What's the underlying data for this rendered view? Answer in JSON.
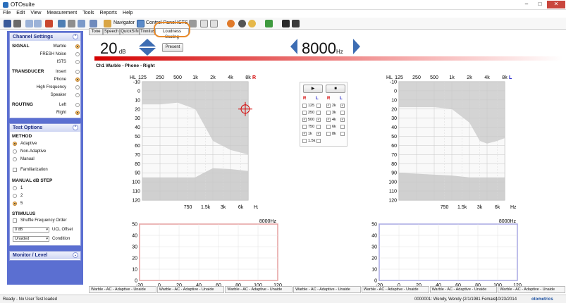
{
  "window": {
    "title": "OTOsuite",
    "min_label": "–",
    "max_label": "□",
    "close_label": "✕"
  },
  "menu": [
    "File",
    "Edit",
    "View",
    "Measurement",
    "Tools",
    "Reports",
    "Help"
  ],
  "toolbar": {
    "navigator_label": "Navigator",
    "control_panel_label": "Control Panel",
    "ists_label": "ISTS"
  },
  "left_panel": {
    "channel_settings": {
      "title": "Channel Settings",
      "signal_label": "SIGNAL",
      "signal_options": [
        "Warble",
        "FRESH Noise",
        "ISTS"
      ],
      "transducer_label": "TRANSDUCER",
      "transducer_options": [
        "Insert",
        "Phone",
        "High Frequency",
        "Speaker"
      ],
      "routing_label": "ROUTING",
      "routing_options": [
        "Left",
        "Right"
      ]
    },
    "test_options": {
      "title": "Test Options",
      "method_label": "METHOD",
      "method_options": [
        "Adaptive",
        "Non-Adaptive",
        "Manual"
      ],
      "familiarization_label": "Familiarization",
      "step_label": "MANUAL dB STEP",
      "step_options": [
        "1",
        "2",
        "5"
      ],
      "stimulus_label": "STIMULUS",
      "shuffle_label": "Shuffle Frequency Order",
      "ucl_offset_value": "0 dB",
      "ucl_offset_label": "UCL Offset",
      "condition_value": "Unaided",
      "condition_label": "Condition"
    },
    "monitor_level": {
      "title": "Monitor / Level"
    }
  },
  "tabs": [
    "Tone",
    "Speech",
    "QuickSIN",
    "Tinnitus",
    "Loudness Scaling"
  ],
  "main": {
    "level_value": "20",
    "level_unit": "dB",
    "present_label": "Present",
    "freq_value": "8000",
    "freq_unit": "Hz",
    "channel_label": "Ch1  Warble - Phone - Right"
  },
  "play_controls": {
    "play_icon": "play-icon",
    "stop_icon": "stop-icon"
  },
  "freq_checks": {
    "headers": [
      "R",
      "L",
      "R",
      "L"
    ],
    "left_col": [
      {
        "f": "125",
        "r": false,
        "l": false
      },
      {
        "f": "250",
        "r": false,
        "l": false
      },
      {
        "f": "500",
        "r": true,
        "l": true
      },
      {
        "f": "750",
        "r": false,
        "l": false
      },
      {
        "f": "1k",
        "r": true,
        "l": true
      },
      {
        "f": "1.5k",
        "r": false,
        "l": false
      }
    ],
    "right_col": [
      {
        "f": "2k",
        "r": true,
        "l": true
      },
      {
        "f": "3k",
        "r": false,
        "l": false
      },
      {
        "f": "4k",
        "r": true,
        "l": true
      },
      {
        "f": "6k",
        "r": false,
        "l": false
      },
      {
        "f": "8k",
        "r": false,
        "l": false
      }
    ]
  },
  "audiogram": {
    "hl_label": "HL",
    "top_ticks": [
      "125",
      "250",
      "500",
      "1k",
      "2k",
      "4k",
      "8k"
    ],
    "bottom_ticks": [
      "750",
      "1.5k",
      "3k",
      "6k"
    ],
    "hz_label": "Hz",
    "y_ticks": [
      "-10",
      "0",
      "10",
      "20",
      "30",
      "40",
      "50",
      "60",
      "70",
      "80",
      "90",
      "100",
      "110",
      "120"
    ],
    "right_ear_label": "R",
    "left_ear_label": "L",
    "right_color": "#d40000",
    "left_color": "#1a1ac8",
    "right_upper_curve": [
      [
        125,
        15
      ],
      [
        250,
        15
      ],
      [
        500,
        13
      ],
      [
        1000,
        20
      ],
      [
        2000,
        55
      ],
      [
        4000,
        65
      ],
      [
        8000,
        70
      ]
    ],
    "left_upper_curve": [
      [
        125,
        18
      ],
      [
        250,
        18
      ],
      [
        500,
        18
      ],
      [
        1000,
        20
      ],
      [
        2000,
        35
      ],
      [
        3000,
        55
      ],
      [
        4000,
        58
      ],
      [
        6000,
        55
      ],
      [
        8000,
        52
      ]
    ],
    "lower_curve_right": [
      [
        125,
        95
      ],
      [
        1000,
        95
      ],
      [
        1500,
        89
      ],
      [
        2000,
        85
      ],
      [
        4000,
        86
      ],
      [
        8000,
        88
      ]
    ],
    "lower_curve_left": [
      [
        125,
        90
      ],
      [
        1000,
        93
      ],
      [
        2000,
        95
      ],
      [
        8000,
        95
      ]
    ],
    "marker": {
      "freq": 8000,
      "level": 20
    }
  },
  "loudness_charts": {
    "freq_label": "8000Hz",
    "y_ticks": [
      "50",
      "40",
      "30",
      "20",
      "10",
      "0"
    ],
    "x_ticks": [
      "-20",
      "0",
      "20",
      "40",
      "60",
      "80",
      "100",
      "120"
    ]
  },
  "bottom_tabs": [
    "Warble - AC - Adaptive - Unaide",
    "Warble - AC - Adaptive - Unaide",
    "Warble - AC - Adaptive - Unaide",
    "Warble - AC - Adaptive - Unaide",
    "Warble - AC - Adaptive - Unaide",
    "Warble - AC - Adaptive - Unaide",
    "Warble - AC - Adaptive - Unaide"
  ],
  "status": {
    "left": "Ready - No User Test loaded",
    "patient": "0000001: Wendy, Wendy (2/1/1981 Female)",
    "date": "10/23/2014",
    "brand": "otometrics"
  }
}
